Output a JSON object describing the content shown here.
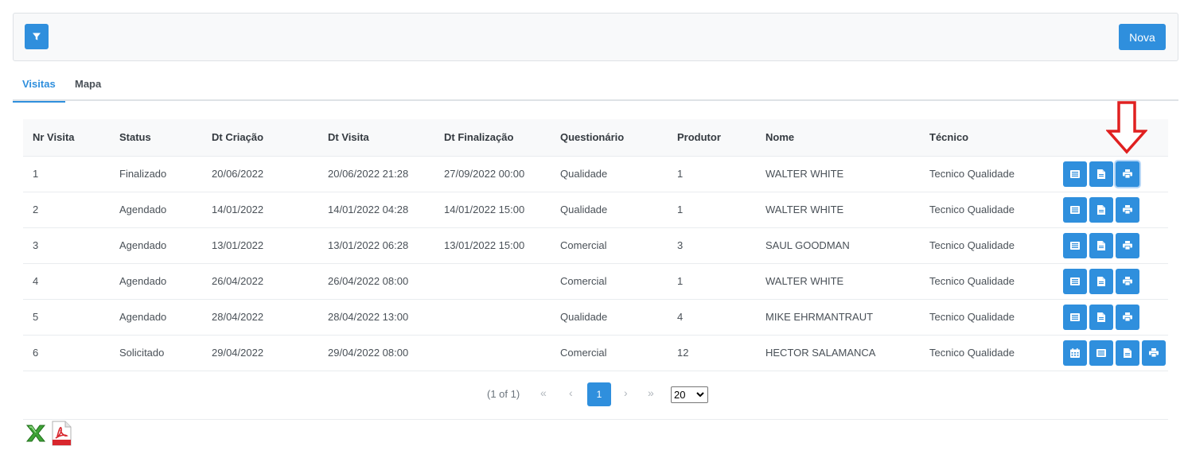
{
  "toolbar": {
    "nova_label": "Nova",
    "filter_icon": "filter-icon"
  },
  "tabs": [
    {
      "label": "Visitas",
      "active": true
    },
    {
      "label": "Mapa",
      "active": false
    }
  ],
  "table": {
    "columns": [
      "Nr Visita",
      "Status",
      "Dt Criação",
      "Dt Visita",
      "Dt Finalização",
      "Questionário",
      "Produtor",
      "Nome",
      "Técnico"
    ],
    "rows": [
      {
        "nr": "1",
        "status": "Finalizado",
        "dt_criacao": "20/06/2022",
        "dt_visita": "20/06/2022 21:28",
        "dt_finalizacao": "27/09/2022 00:00",
        "questionario": "Qualidade",
        "produtor": "1",
        "nome": "WALTER WHITE",
        "tecnico": "Tecnico Qualidade"
      },
      {
        "nr": "2",
        "status": "Agendado",
        "dt_criacao": "14/01/2022",
        "dt_visita": "14/01/2022 04:28",
        "dt_finalizacao": "14/01/2022 15:00",
        "questionario": "Qualidade",
        "produtor": "1",
        "nome": "WALTER WHITE",
        "tecnico": "Tecnico Qualidade"
      },
      {
        "nr": "3",
        "status": "Agendado",
        "dt_criacao": "13/01/2022",
        "dt_visita": "13/01/2022 06:28",
        "dt_finalizacao": "13/01/2022 15:00",
        "questionario": "Comercial",
        "produtor": "3",
        "nome": "SAUL GOODMAN",
        "tecnico": "Tecnico Qualidade"
      },
      {
        "nr": "4",
        "status": "Agendado",
        "dt_criacao": "26/04/2022",
        "dt_visita": "26/04/2022 08:00",
        "dt_finalizacao": "",
        "questionario": "Comercial",
        "produtor": "1",
        "nome": "WALTER WHITE",
        "tecnico": "Tecnico Qualidade"
      },
      {
        "nr": "5",
        "status": "Agendado",
        "dt_criacao": "28/04/2022",
        "dt_visita": "28/04/2022 13:00",
        "dt_finalizacao": "",
        "questionario": "Qualidade",
        "produtor": "4",
        "nome": "MIKE EHRMANTRAUT",
        "tecnico": "Tecnico Qualidade"
      },
      {
        "nr": "6",
        "status": "Solicitado",
        "dt_criacao": "29/04/2022",
        "dt_visita": "29/04/2022 08:00",
        "dt_finalizacao": "",
        "questionario": "Comercial",
        "produtor": "12",
        "nome": "HECTOR SALAMANCA",
        "tecnico": "Tecnico Qualidade"
      }
    ]
  },
  "paginator": {
    "report": "(1 of 1)",
    "current_page": "1",
    "rows_per_page": "20",
    "first": "«",
    "prev": "‹",
    "next": "›",
    "last": "»"
  },
  "colors": {
    "primary": "#2f8fdd",
    "annotation_arrow": "#e02020"
  }
}
